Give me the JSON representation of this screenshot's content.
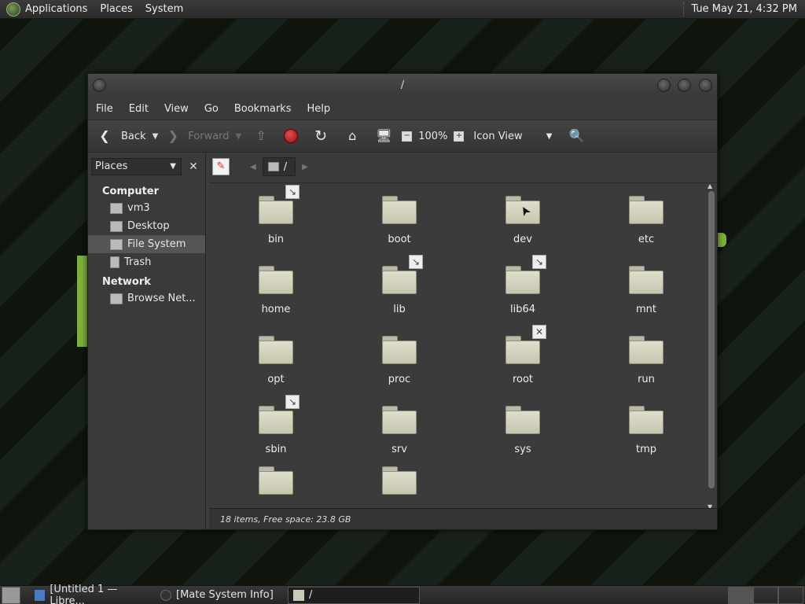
{
  "top_panel": {
    "applications": "Applications",
    "places": "Places",
    "system": "System",
    "clock": "Tue May 21,  4:32 PM"
  },
  "window": {
    "title": "/",
    "menu": [
      "File",
      "Edit",
      "View",
      "Go",
      "Bookmarks",
      "Help"
    ],
    "toolbar": {
      "back": "Back",
      "forward": "Forward",
      "zoom": "100%",
      "view_mode": "Icon View"
    },
    "sidebar": {
      "combo": "Places",
      "sections": [
        {
          "title": "Computer",
          "items": [
            "vm3",
            "Desktop",
            "File System",
            "Trash"
          ]
        },
        {
          "title": "Network",
          "items": [
            "Browse Net..."
          ]
        }
      ],
      "selected": "File System"
    },
    "pathbar": {
      "crumb": "/"
    },
    "files": [
      {
        "name": "bin",
        "emblem": "↘"
      },
      {
        "name": "boot",
        "emblem": ""
      },
      {
        "name": "dev",
        "emblem": ""
      },
      {
        "name": "etc",
        "emblem": ""
      },
      {
        "name": "home",
        "emblem": ""
      },
      {
        "name": "lib",
        "emblem": "↘"
      },
      {
        "name": "lib64",
        "emblem": "↘"
      },
      {
        "name": "mnt",
        "emblem": ""
      },
      {
        "name": "opt",
        "emblem": ""
      },
      {
        "name": "proc",
        "emblem": ""
      },
      {
        "name": "root",
        "emblem": "✕"
      },
      {
        "name": "run",
        "emblem": ""
      },
      {
        "name": "sbin",
        "emblem": "↘"
      },
      {
        "name": "srv",
        "emblem": ""
      },
      {
        "name": "sys",
        "emblem": ""
      },
      {
        "name": "tmp",
        "emblem": ""
      },
      {
        "name": "",
        "emblem": ""
      },
      {
        "name": "",
        "emblem": ""
      }
    ],
    "status": "18 items, Free space: 23.8 GB"
  },
  "taskbar": {
    "tasks": [
      "[Untitled 1 — Libre...",
      "[Mate System Info]",
      "/"
    ]
  }
}
